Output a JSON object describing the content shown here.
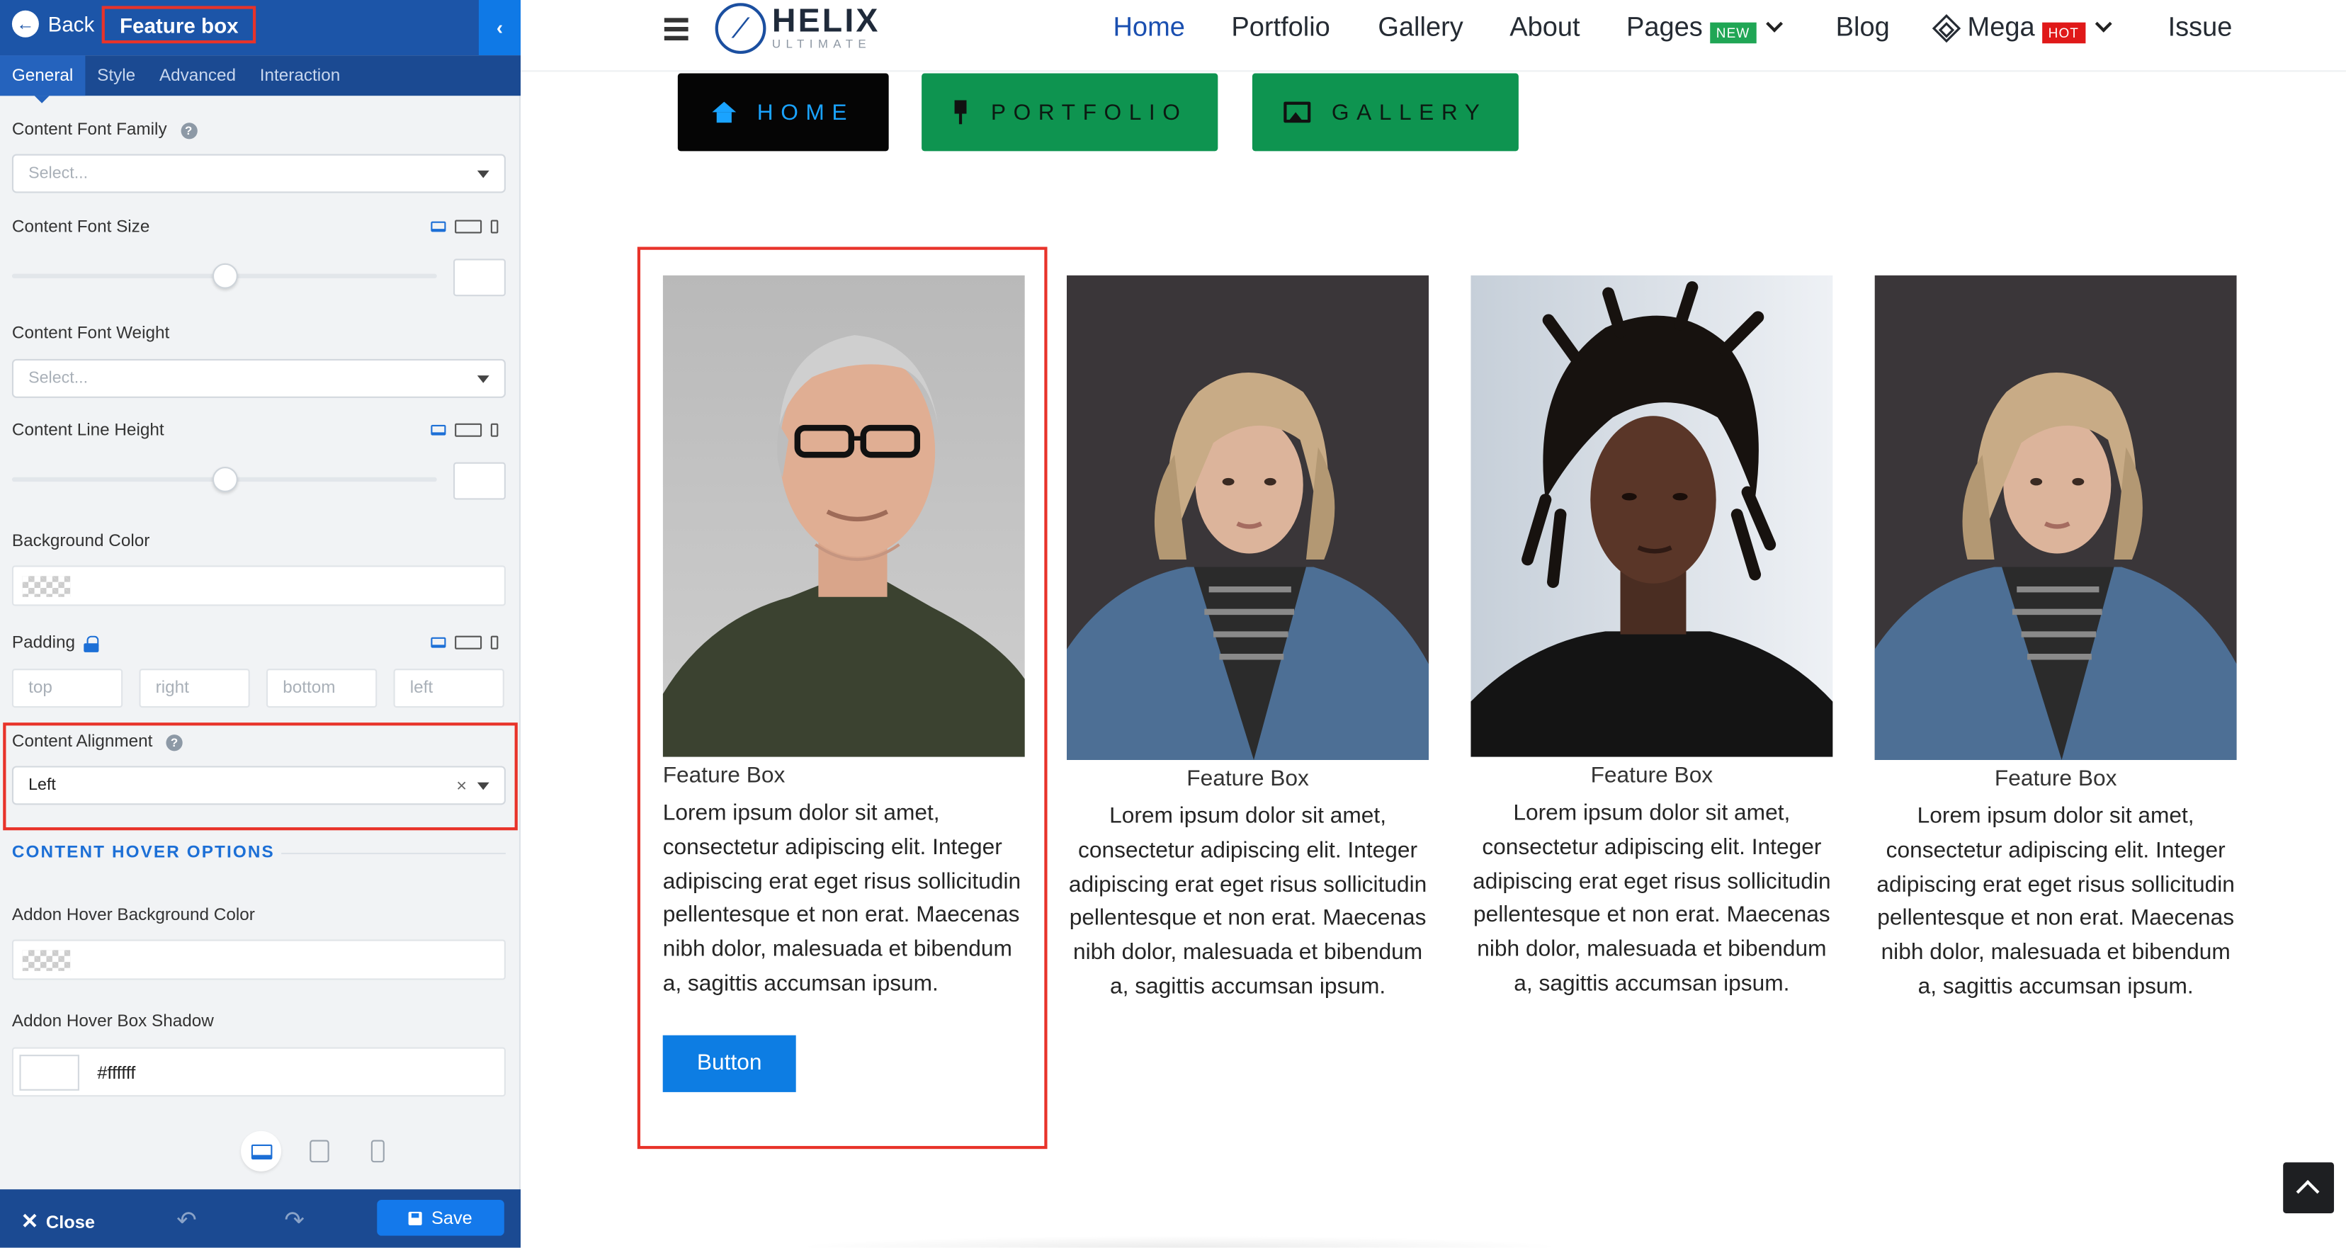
{
  "editor": {
    "back_label": "Back",
    "title": "Feature box",
    "tabs": [
      "General",
      "Style",
      "Advanced",
      "Interaction"
    ],
    "fields": {
      "content_font_family": {
        "label": "Content Font Family",
        "placeholder": "Select..."
      },
      "content_font_size": {
        "label": "Content Font Size",
        "slider_level": 0.5
      },
      "content_font_weight": {
        "label": "Content Font Weight",
        "placeholder": "Select..."
      },
      "content_line_height": {
        "label": "Content Line Height",
        "slider_level": 0.5
      },
      "background_color": {
        "label": "Background Color"
      },
      "padding": {
        "label": "Padding",
        "placeholders": [
          "top",
          "right",
          "bottom",
          "left"
        ]
      },
      "content_alignment": {
        "label": "Content Alignment",
        "value": "Left"
      }
    },
    "hover_heading": "CONTENT HOVER OPTIONS",
    "hover_fields": {
      "bg_color": {
        "label": "Addon Hover Background Color"
      },
      "box_shadow": {
        "label": "Addon Hover Box Shadow",
        "value": "#ffffff"
      }
    },
    "footer": {
      "close_label": "Close",
      "save_label": "Save"
    }
  },
  "site": {
    "logo": {
      "name": "HELIX",
      "sub": "ULTIMATE"
    },
    "nav": [
      {
        "label": "Home",
        "active": true
      },
      {
        "label": "Portfolio"
      },
      {
        "label": "Gallery"
      },
      {
        "label": "About"
      },
      {
        "label": "Pages",
        "badge": "NEW",
        "badge_color": "#20a655",
        "dropdown": true
      },
      {
        "label": "Blog"
      },
      {
        "label": "Mega",
        "badge": "HOT",
        "badge_color": "#e01919",
        "dropdown": true,
        "icon": "codepen-icon"
      },
      {
        "label": "Issue"
      }
    ],
    "cta_buttons": [
      {
        "label": "HOME",
        "icon": "home-icon",
        "bg": "#050505",
        "color": "#1aa3ff"
      },
      {
        "label": "PORTFOLIO",
        "icon": "pin-icon",
        "bg": "#0e9450",
        "color": "#0c1a12"
      },
      {
        "label": "GALLERY",
        "icon": "gallery-icon",
        "bg": "#0e9450",
        "color": "#0c1a12"
      }
    ],
    "cards": [
      {
        "title": "Feature Box",
        "text": "Lorem ipsum dolor sit amet, consectetur adipiscing elit. Integer adipiscing erat eget risus sollicitudin pellentesque et non erat. Maecenas nibh dolor, malesuada et bibendum a, sagittis accumsan ipsum.",
        "button": "Button",
        "align": "left",
        "photo": "man-gray-hair-glasses"
      },
      {
        "title": "Feature Box",
        "text": "Lorem ipsum dolor sit amet, consectetur adipiscing elit. Integer adipiscing erat eget risus sollicitudin pellentesque et non erat. Maecenas nibh dolor, malesuada et bibendum a, sagittis accumsan ipsum.",
        "align": "center",
        "photo": "woman-denim-jacket"
      },
      {
        "title": "Feature Box",
        "text": "Lorem ipsum dolor sit amet, consectetur adipiscing elit. Integer adipiscing erat eget risus sollicitudin pellentesque et non erat. Maecenas nibh dolor, malesuada et bibendum a, sagittis accumsan ipsum.",
        "align": "center",
        "photo": "man-dreadlocks"
      },
      {
        "title": "Feature Box",
        "text": "Lorem ipsum dolor sit amet, consectetur adipiscing elit. Integer adipiscing erat eget risus sollicitudin pellentesque et non erat. Maecenas nibh dolor, malesuada et bibendum a, sagittis accumsan ipsum.",
        "align": "center",
        "photo": "woman-denim-jacket"
      }
    ]
  },
  "colors": {
    "editor_blue": "#1c55a8",
    "accent_red": "#e8332a",
    "link_blue": "#1a4fb0",
    "button_blue": "#0d7de3",
    "green": "#0e9450"
  }
}
